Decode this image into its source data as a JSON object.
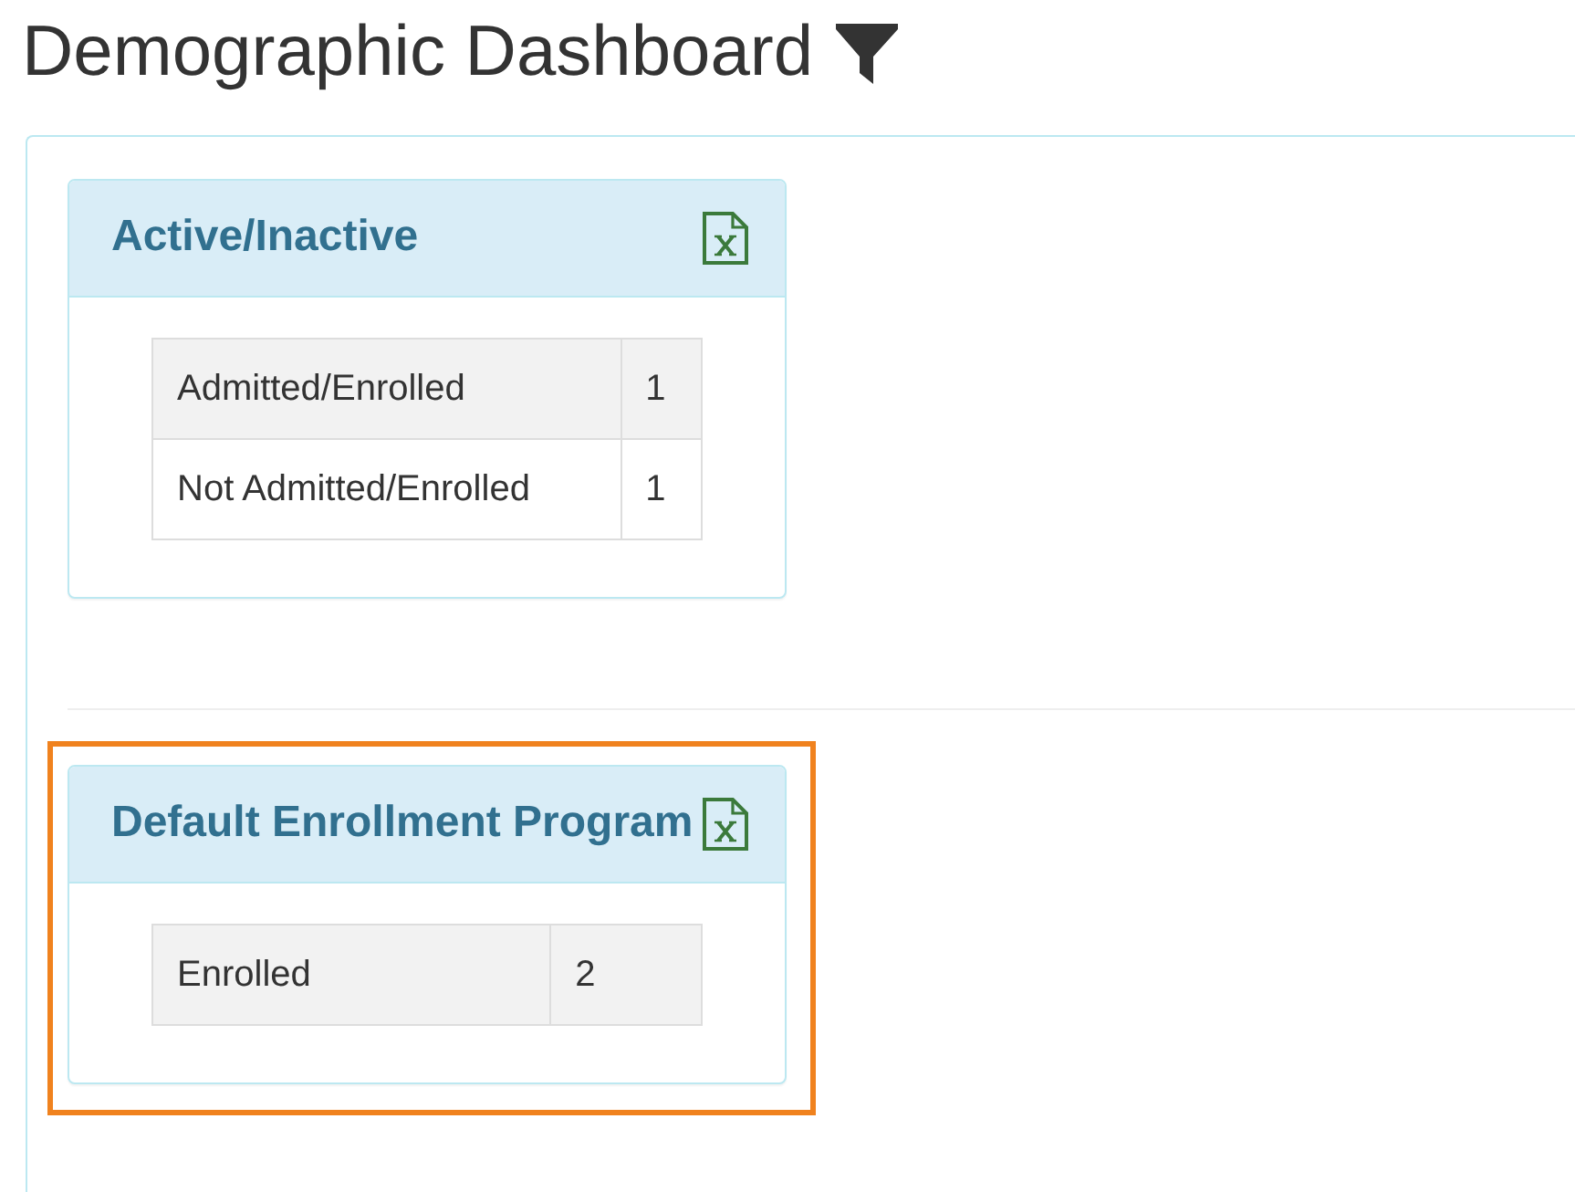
{
  "page": {
    "title": "Demographic Dashboard"
  },
  "panels": [
    {
      "title": "Active/Inactive",
      "highlighted": false,
      "rows": [
        {
          "label": "Admitted/Enrolled",
          "count": "1"
        },
        {
          "label": "Not Admitted/Enrolled",
          "count": "1"
        }
      ]
    },
    {
      "title": "Default Enrollment Program",
      "highlighted": true,
      "rows": [
        {
          "label": "Enrolled",
          "count": "2"
        }
      ]
    }
  ]
}
